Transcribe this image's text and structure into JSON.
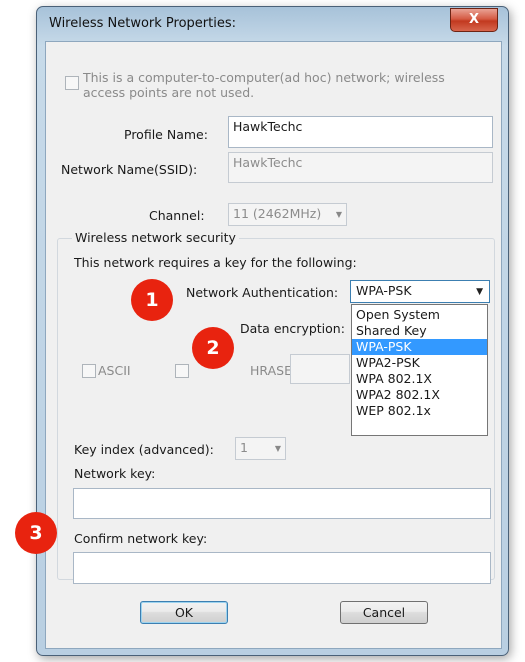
{
  "window": {
    "title": "Wireless Network Properties:",
    "close_label": "X"
  },
  "adhoc": {
    "label_line1": "This is a computer-to-computer(ad hoc) network; wireless",
    "label_line2": "access points are not used."
  },
  "profile": {
    "label": "Profile Name:",
    "value": "HawkTechc"
  },
  "ssid": {
    "label": "Network Name(SSID):",
    "value": "HawkTechc"
  },
  "channel": {
    "label": "Channel:",
    "value": "11 (2462MHz)"
  },
  "security": {
    "group_title": "Wireless network security",
    "requires_text": "This network requires a key for the following:",
    "auth_label": "Network Authentication:",
    "auth_value": "WPA-PSK",
    "auth_options": [
      "Open System",
      "Shared Key",
      "WPA-PSK",
      "WPA2-PSK",
      "WPA 802.1X",
      "WPA2 802.1X",
      "WEP 802.1x"
    ],
    "auth_selected_index": 2,
    "encryption_label": "Data encryption:",
    "ascii_label": "ASCII",
    "passphrase_label": "HRASE",
    "key_index_label": "Key index (advanced):",
    "key_index_value": "1",
    "network_key_label": "Network key:",
    "network_key_value": "",
    "confirm_key_label": "Confirm network key:",
    "confirm_key_value": ""
  },
  "buttons": {
    "ok": "OK",
    "cancel": "Cancel"
  },
  "annotations": [
    "1",
    "2",
    "3"
  ]
}
